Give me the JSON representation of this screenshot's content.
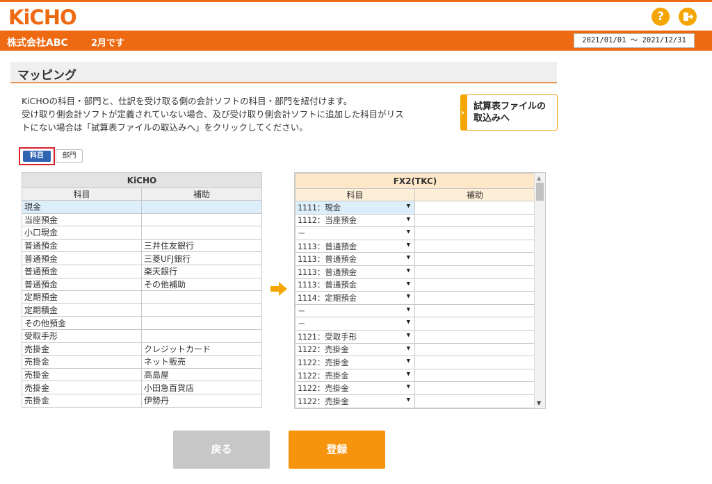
{
  "header": {
    "logo_text": "KiCHO",
    "company": "株式会社ABC",
    "month": "2月です",
    "period": "2021/01/01 ～ 2021/12/31",
    "help_glyph": "?"
  },
  "page": {
    "title": "マッピング",
    "description": [
      "KiCHOの科目・部門と、仕訳を受け取る側の会計ソフトの科目・部門を紐付けます。",
      "受け取り側会計ソフトが定義されていない場合、及び受け取り側会計ソフトに追加した科目がリス",
      "トにない場合は「試算表ファイルの取込みへ」をクリックしてください。"
    ],
    "import_button": [
      "試算表ファイルの",
      "取込みへ"
    ]
  },
  "tabs": {
    "account": "科目",
    "department": "部門"
  },
  "left_table": {
    "group_header": "KiCHO",
    "col_account": "科目",
    "col_sub": "補助",
    "rows": [
      [
        "現金",
        ""
      ],
      [
        "当座預金",
        ""
      ],
      [
        "小口現金",
        ""
      ],
      [
        "普通預金",
        "三井住友銀行"
      ],
      [
        "普通預金",
        "三菱UFJ銀行"
      ],
      [
        "普通預金",
        "楽天銀行"
      ],
      [
        "普通預金",
        "その他補助"
      ],
      [
        "定期預金",
        ""
      ],
      [
        "定期積金",
        ""
      ],
      [
        "その他預金",
        ""
      ],
      [
        "受取手形",
        ""
      ],
      [
        "売掛金",
        "クレジットカード"
      ],
      [
        "売掛金",
        "ネット販売"
      ],
      [
        "売掛金",
        "高島屋"
      ],
      [
        "売掛金",
        "小田急百貨店"
      ],
      [
        "売掛金",
        "伊勢丹"
      ]
    ]
  },
  "right_table": {
    "group_header": "FX2(TKC)",
    "col_account": "科目",
    "col_sub": "補助",
    "rows": [
      [
        "1111：現金",
        ""
      ],
      [
        "1112：当座預金",
        ""
      ],
      [
        "－",
        ""
      ],
      [
        "1113：普通預金",
        ""
      ],
      [
        "1113：普通預金",
        ""
      ],
      [
        "1113：普通預金",
        ""
      ],
      [
        "1113：普通預金",
        ""
      ],
      [
        "1114：定期預金",
        ""
      ],
      [
        "－",
        ""
      ],
      [
        "－",
        ""
      ],
      [
        "1121：受取手形",
        ""
      ],
      [
        "1122：売掛金",
        ""
      ],
      [
        "1122：売掛金",
        ""
      ],
      [
        "1122：売掛金",
        ""
      ],
      [
        "1122：売掛金",
        ""
      ],
      [
        "1122：売掛金",
        ""
      ]
    ]
  },
  "buttons": {
    "back": "戻る",
    "register": "登録"
  },
  "colors": {
    "brand": "#ee6a12",
    "accent": "#f7940d",
    "tab_active": "#2f64b3",
    "highlight": "#ddeefb"
  },
  "icons": [
    "help-icon",
    "logout-icon",
    "arrow-right-icon",
    "caret-down-icon",
    "chevron-right-icon"
  ]
}
